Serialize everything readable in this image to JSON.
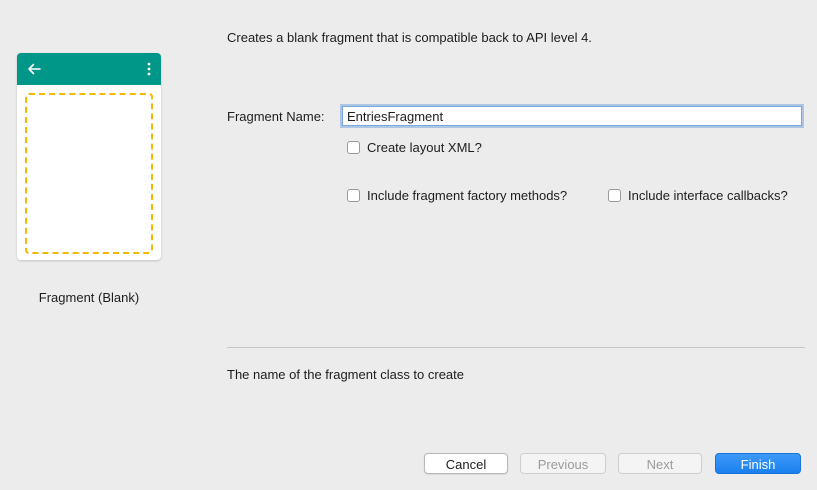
{
  "template": {
    "name": "Fragment (Blank)",
    "appbar_color": "#009688",
    "fragment_outline_color": "#f5b800",
    "back_icon": "arrow-left-icon",
    "overflow_icon": "more-vert-icon"
  },
  "description": "Creates a blank fragment that is compatible back to API level 4.",
  "form": {
    "fragment_name_label": "Fragment Name:",
    "fragment_name_value": "EntriesFragment",
    "create_layout_xml_label": "Create layout XML?",
    "create_layout_xml_checked": false,
    "include_factory_methods_label": "Include fragment factory methods?",
    "include_factory_methods_checked": false,
    "include_interface_callbacks_label": "Include interface callbacks?",
    "include_interface_callbacks_checked": false
  },
  "help_text": "The name of the fragment class to create",
  "buttons": {
    "cancel": "Cancel",
    "previous": "Previous",
    "next": "Next",
    "finish": "Finish"
  }
}
